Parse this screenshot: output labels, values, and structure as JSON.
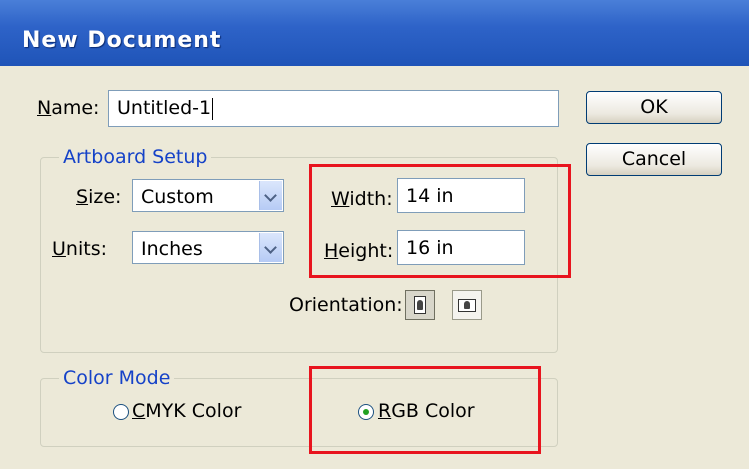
{
  "window": {
    "title": "New Document"
  },
  "name_field": {
    "label": "Name:",
    "accesskey": "N",
    "label_rest": "ame:",
    "value": "Untitled-1"
  },
  "buttons": {
    "ok": "OK",
    "cancel": "Cancel"
  },
  "artboard": {
    "legend": "Artboard Setup",
    "size": {
      "label_ak": "S",
      "label_rest": "ize:",
      "value": "Custom"
    },
    "units": {
      "label_ak": "U",
      "label_rest": "nits:",
      "value": "Inches"
    },
    "width": {
      "label_ak": "W",
      "label_rest": "idth:",
      "value": "14 in"
    },
    "height": {
      "label_ak": "H",
      "label_rest": "eight:",
      "value": "16 in"
    },
    "orientation": {
      "label": "Orientation:",
      "selected": "portrait"
    }
  },
  "color_mode": {
    "legend": "Color Mode",
    "cmyk": {
      "label_ak": "C",
      "label_rest": "MYK Color",
      "selected": false
    },
    "rgb": {
      "label_ak": "R",
      "label_rest": "GB Color",
      "selected": true
    }
  },
  "colors": {
    "highlight": "#e8141e",
    "titlebar": "#2e63c8",
    "legend_text": "#1542c8"
  }
}
